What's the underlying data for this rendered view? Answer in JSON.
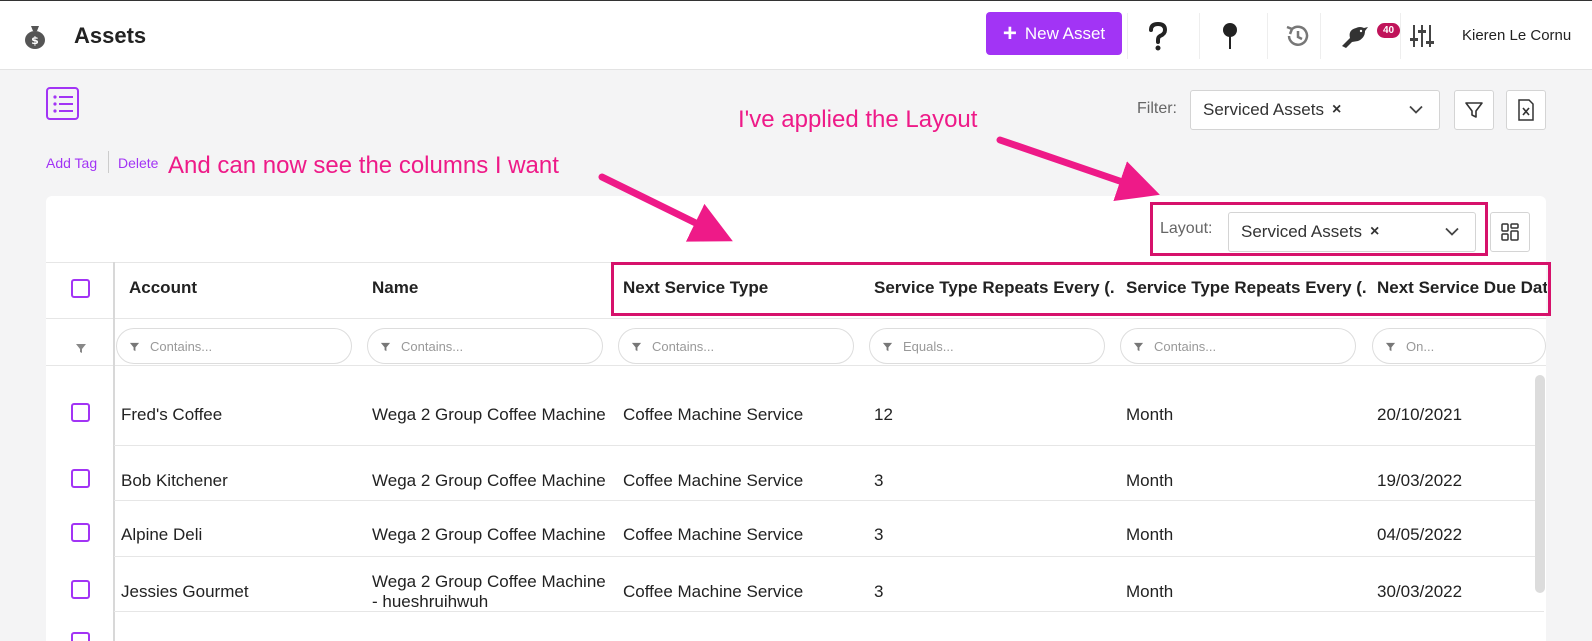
{
  "header": {
    "title": "Assets",
    "new_button_label": "New Asset",
    "notification_count": "40",
    "user_name": "Kieren Le Cornu"
  },
  "toolbar": {
    "filter_label": "Filter:",
    "filter_value": "Serviced Assets",
    "actions": {
      "add_tag": "Add Tag",
      "delete": "Delete"
    }
  },
  "layout": {
    "label": "Layout:",
    "value": "Serviced Assets"
  },
  "grid": {
    "columns": [
      {
        "label": "Account",
        "filter_placeholder": "Contains..."
      },
      {
        "label": "Name",
        "filter_placeholder": "Contains..."
      },
      {
        "label": "Next Service Type",
        "filter_placeholder": "Contains..."
      },
      {
        "label": "Service Type Repeats Every (...",
        "filter_placeholder": "Equals..."
      },
      {
        "label": "Service Type Repeats Every (...",
        "filter_placeholder": "Contains..."
      },
      {
        "label": "Next Service Due Date",
        "filter_placeholder": "On..."
      }
    ],
    "rows": [
      {
        "account": "Fred's Coffee",
        "name": "Wega 2 Group Coffee Machine",
        "service_type": "Coffee Machine Service",
        "repeats_value": "12",
        "repeats_unit": "Month",
        "due_date": "20/10/2021"
      },
      {
        "account": "Bob Kitchener",
        "name": "Wega 2 Group Coffee Machine",
        "service_type": "Coffee Machine Service",
        "repeats_value": "3",
        "repeats_unit": "Month",
        "due_date": "19/03/2022"
      },
      {
        "account": "Alpine Deli",
        "name": "Wega 2 Group Coffee Machine",
        "service_type": "Coffee Machine Service",
        "repeats_value": "3",
        "repeats_unit": "Month",
        "due_date": "04/05/2022"
      },
      {
        "account": "Jessies Gourmet",
        "name": "Wega 2 Group Coffee Machine - hueshruihwuh",
        "service_type": "Coffee Machine Service",
        "repeats_value": "3",
        "repeats_unit": "Month",
        "due_date": "30/03/2022"
      }
    ]
  },
  "annotations": {
    "layout_note": "I've applied the Layout",
    "columns_note": "And can now see the columns I want",
    "color": "#ee1a88"
  },
  "colors": {
    "accent": "#a234f5",
    "annotation": "#d6116b"
  }
}
